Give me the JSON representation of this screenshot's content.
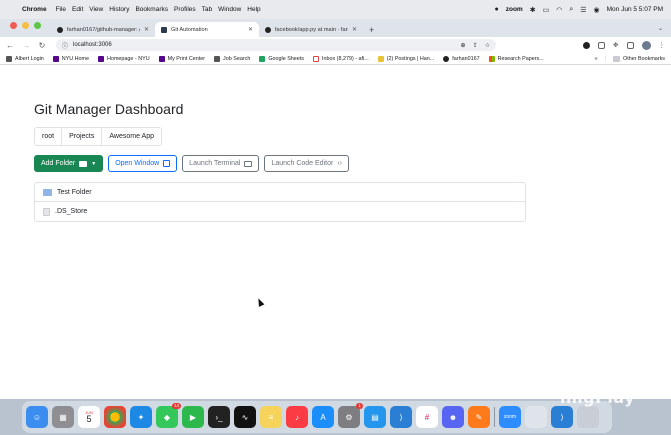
{
  "menubar": {
    "app": "Chrome",
    "items": [
      "File",
      "Edit",
      "View",
      "History",
      "Bookmarks",
      "Profiles",
      "Tab",
      "Window",
      "Help"
    ],
    "zoom_label": "zoom",
    "datetime": "Mon Jun 5  5:07 PM"
  },
  "tabs": [
    {
      "label": "farhan0167/github-manager: A",
      "active": false,
      "icon": "github-icon"
    },
    {
      "label": "Git Automation",
      "active": true,
      "icon": "page-icon"
    },
    {
      "label": "facebook/app.py at main · farh",
      "active": false,
      "icon": "github-icon"
    }
  ],
  "toolbar": {
    "url": "localhost:3006"
  },
  "bookmarks": [
    {
      "label": "Albert Login",
      "icon": "key-icon"
    },
    {
      "label": "NYU Home",
      "icon": "nyu-icon"
    },
    {
      "label": "Homepage - NYU",
      "icon": "nyu-icon"
    },
    {
      "label": "My Print Center",
      "icon": "nyu-icon"
    },
    {
      "label": "Job Search",
      "icon": "job-icon"
    },
    {
      "label": "Google Sheets",
      "icon": "sheets-icon"
    },
    {
      "label": "Inbox (8,279) - afi...",
      "icon": "gmail-icon"
    },
    {
      "label": "(2) Postings | Han...",
      "icon": "handshake-icon"
    },
    {
      "label": "farhan0167",
      "icon": "github-icon"
    },
    {
      "label": "Research Papers...",
      "icon": "microsoft-icon"
    }
  ],
  "bookmarks_more": "»",
  "other_bookmarks": "Other Bookmarks",
  "page": {
    "title": "Git Manager Dashboard",
    "breadcrumb": [
      "root",
      "Projects",
      "Awesome App"
    ],
    "buttons": {
      "add_folder": "Add Folder",
      "open_window": "Open Window",
      "launch_terminal": "Launch Terminal",
      "launch_code_editor": "Launch Code Editor"
    },
    "files": [
      {
        "name": "Test Folder",
        "type": "folder"
      },
      {
        "name": ".DS_Store",
        "type": "file"
      }
    ]
  },
  "dock": {
    "calendar_month": "JUN",
    "calendar_day": "5",
    "messages_badge": "14",
    "settings_badge": "1",
    "zoom_label": "zoom"
  },
  "watermark": "imgPlay"
}
